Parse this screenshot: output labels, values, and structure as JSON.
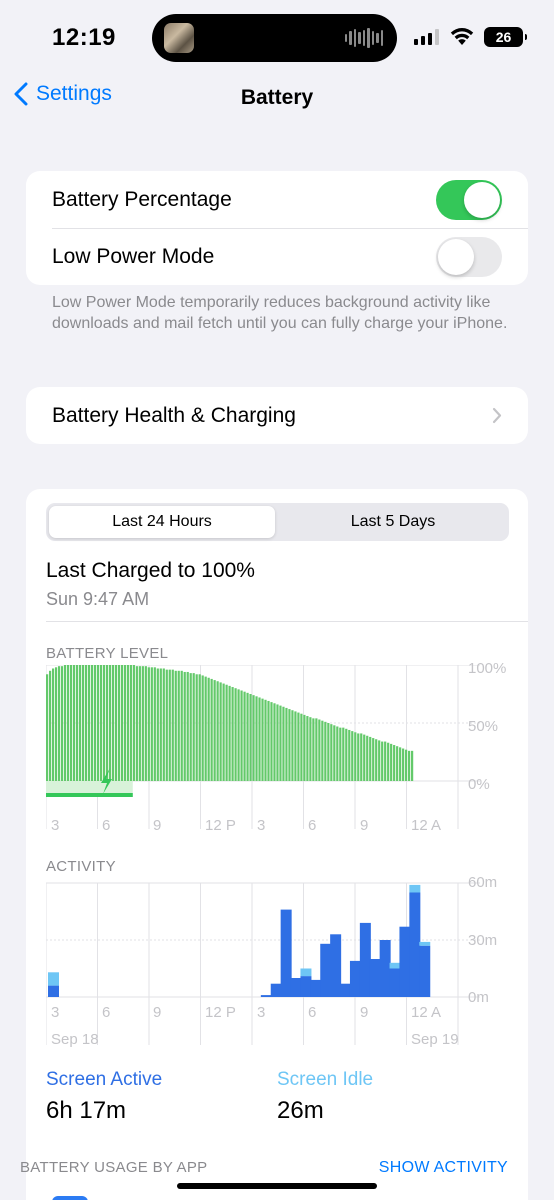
{
  "status": {
    "time": "12:19",
    "battery_level": "26"
  },
  "nav": {
    "back_label": "Settings",
    "title": "Battery"
  },
  "settings": {
    "battery_percentage_label": "Battery Percentage",
    "battery_percentage_on": true,
    "low_power_label": "Low Power Mode",
    "low_power_on": false,
    "low_power_footnote": "Low Power Mode temporarily reduces background activity like downloads and mail fetch until you can fully charge your iPhone.",
    "health_label": "Battery Health & Charging"
  },
  "usage": {
    "tabs": [
      "Last 24 Hours",
      "Last 5 Days"
    ],
    "selected_tab": "Last 24 Hours",
    "last_charged_title": "Last Charged to 100%",
    "last_charged_time": "Sun 9:47 AM",
    "battery_level_label": "BATTERY LEVEL",
    "activity_label": "ACTIVITY",
    "screen_active_label": "Screen Active",
    "screen_active_value": "6h 17m",
    "screen_idle_label": "Screen Idle",
    "screen_idle_value": "26m",
    "by_app_label": "BATTERY USAGE BY APP",
    "show_activity_label": "SHOW ACTIVITY"
  },
  "colors": {
    "accent": "#007aff",
    "toggle_on": "#34c759",
    "battery_bar": "#63c96a",
    "charging": "#34c759",
    "screen_active": "#2f6fe4",
    "screen_idle": "#6ec6f5"
  },
  "chart_data": [
    {
      "type": "bar",
      "title": "BATTERY LEVEL",
      "x_tick_labels": [
        "3",
        "6",
        "9",
        "12 P",
        "3",
        "6",
        "9",
        "12 A"
      ],
      "y_tick_labels": [
        "100%",
        "50%",
        "0%"
      ],
      "ylim": [
        0,
        100
      ],
      "charging_period_bars": 29,
      "values": [
        92,
        95,
        97,
        98,
        99,
        99,
        100,
        100,
        100,
        100,
        100,
        100,
        100,
        100,
        100,
        100,
        100,
        100,
        100,
        100,
        100,
        100,
        100,
        100,
        100,
        100,
        100,
        100,
        100,
        100,
        99,
        99,
        99,
        99,
        98,
        98,
        98,
        97,
        97,
        97,
        96,
        96,
        96,
        95,
        95,
        95,
        94,
        94,
        93,
        93,
        92,
        92,
        91,
        90,
        89,
        88,
        87,
        86,
        85,
        84,
        83,
        82,
        81,
        80,
        79,
        78,
        77,
        76,
        75,
        74,
        73,
        72,
        71,
        70,
        69,
        68,
        67,
        66,
        65,
        64,
        63,
        62,
        61,
        60,
        59,
        58,
        57,
        56,
        55,
        54,
        54,
        53,
        52,
        51,
        50,
        49,
        48,
        47,
        46,
        46,
        45,
        44,
        43,
        42,
        41,
        41,
        40,
        39,
        38,
        37,
        36,
        35,
        34,
        34,
        33,
        32,
        31,
        30,
        29,
        28,
        27,
        26,
        26
      ]
    },
    {
      "type": "bar",
      "title": "ACTIVITY",
      "x_tick_labels": [
        "3",
        "6",
        "9",
        "12 P",
        "3",
        "6",
        "9",
        "12 A"
      ],
      "date_labels": [
        "Sep 18",
        "Sep 19"
      ],
      "y_tick_labels": [
        "60m",
        "30m",
        "0m"
      ],
      "ylim": [
        0,
        60
      ],
      "series": [
        {
          "name": "Screen Active",
          "values": [
            6,
            0,
            0,
            0,
            0,
            0,
            0,
            0,
            0,
            0,
            0,
            0,
            0,
            0,
            0,
            0,
            0,
            0,
            0,
            0,
            0,
            0,
            0,
            0,
            0,
            0,
            0,
            0,
            0,
            0,
            0,
            0,
            0,
            0,
            0,
            0,
            0,
            0,
            0,
            0,
            0,
            0,
            0,
            1,
            0,
            7,
            0,
            46,
            0,
            10,
            0,
            11,
            0,
            9,
            0,
            28,
            0,
            33,
            0,
            7,
            0,
            19,
            0,
            39,
            0,
            20,
            0,
            30,
            0,
            15,
            0,
            37,
            0,
            55,
            0,
            27
          ]
        },
        {
          "name": "Screen Idle",
          "values": [
            7,
            0,
            0,
            0,
            0,
            0,
            0,
            0,
            0,
            0,
            0,
            0,
            0,
            0,
            0,
            0,
            0,
            0,
            0,
            0,
            0,
            0,
            0,
            0,
            0,
            0,
            0,
            0,
            0,
            0,
            0,
            0,
            0,
            0,
            0,
            0,
            0,
            0,
            0,
            0,
            0,
            0,
            0,
            0,
            0,
            0,
            0,
            0,
            0,
            0,
            0,
            4,
            0,
            0,
            0,
            0,
            0,
            0,
            0,
            0,
            0,
            0,
            0,
            0,
            0,
            0,
            0,
            0,
            0,
            3,
            0,
            0,
            0,
            4,
            0,
            2
          ]
        }
      ]
    }
  ]
}
